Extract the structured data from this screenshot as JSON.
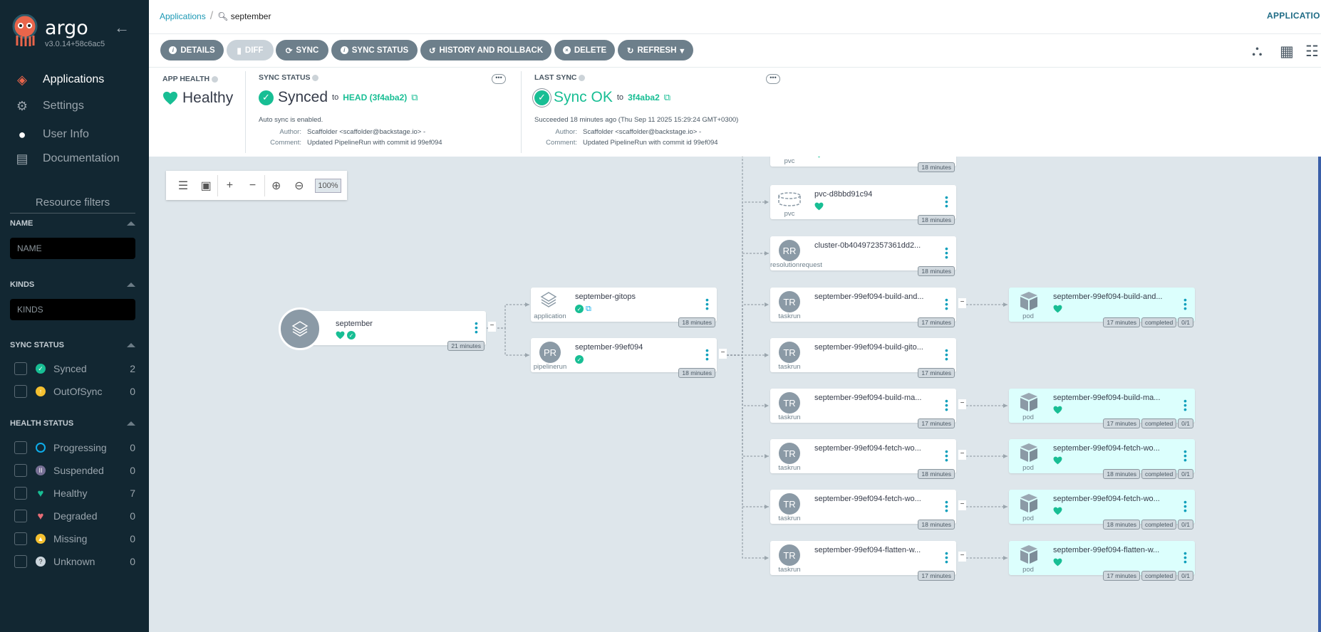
{
  "sidebar": {
    "brand": "argo",
    "version": "v3.0.14+58c6ac5",
    "nav": [
      {
        "label": "Applications",
        "icon": "layers-icon",
        "active": true
      },
      {
        "label": "Settings",
        "icon": "gear-icon"
      },
      {
        "label": "User Info",
        "icon": "user-icon"
      },
      {
        "label": "Documentation",
        "icon": "book-icon"
      }
    ],
    "filters_title": "Resource filters",
    "name_label": "NAME",
    "name_placeholder": "NAME",
    "kinds_label": "KINDS",
    "kinds_placeholder": "KINDS",
    "sync_label": "SYNC STATUS",
    "sync_items": [
      {
        "label": "Synced",
        "count": "2",
        "color": "#18be94"
      },
      {
        "label": "OutOfSync",
        "count": "0",
        "color": "#f4c030"
      }
    ],
    "health_label": "HEALTH STATUS",
    "health_items": [
      {
        "label": "Progressing",
        "count": "0",
        "color": "#0dadea"
      },
      {
        "label": "Suspended",
        "count": "0",
        "color": "#766f94"
      },
      {
        "label": "Healthy",
        "count": "7",
        "color": "#18be94"
      },
      {
        "label": "Degraded",
        "count": "0",
        "color": "#e96d76"
      },
      {
        "label": "Missing",
        "count": "0",
        "color": "#f4c030"
      },
      {
        "label": "Unknown",
        "count": "0",
        "color": "#ccd6dd"
      }
    ]
  },
  "breadcrumb": {
    "root": "Applications",
    "current": "september"
  },
  "page_title": "APPLICATIO",
  "toolbar": {
    "details": "DETAILS",
    "diff": "DIFF",
    "sync": "SYNC",
    "sync_status": "SYNC STATUS",
    "history": "HISTORY AND ROLLBACK",
    "delete": "DELETE",
    "refresh": "REFRESH"
  },
  "app_health": {
    "label": "APP HEALTH",
    "value": "Healthy"
  },
  "sync_status": {
    "label": "SYNC STATUS",
    "value": "Synced",
    "to": "to",
    "revision": "HEAD (3f4aba2)",
    "auto": "Auto sync is enabled.",
    "author_key": "Author:",
    "author": "Scaffolder <scaffolder@backstage.io> -",
    "comment_key": "Comment:",
    "comment": "Updated PipelineRun with commit id 99ef094"
  },
  "last_sync": {
    "label": "LAST SYNC",
    "value": "Sync OK",
    "to": "to",
    "revision": "3f4aba2",
    "succeeded": "Succeeded 18 minutes ago (Thu Sep 11 2025 15:29:24 GMT+0300)",
    "author_key": "Author:",
    "author": "Scaffolder <scaffolder@backstage.io> -",
    "comment_key": "Comment:",
    "comment": "Updated PipelineRun with commit id 99ef094"
  },
  "zoom": {
    "level": "100%"
  },
  "graph": {
    "root": {
      "name": "september",
      "age": "21 minutes",
      "health": "healthy",
      "sync": "synced"
    },
    "level1": [
      {
        "name": "september-gitops",
        "kind": "application",
        "icon": "layers",
        "age": "18 minutes",
        "status": [
          "synced",
          "link"
        ]
      },
      {
        "name": "september-99ef094",
        "kind": "pipelinerun",
        "icon": "PR",
        "age": "18 minutes",
        "status": [
          "synced"
        ]
      }
    ],
    "level2": [
      {
        "name": "",
        "kind": "pvc",
        "icon": "pvc",
        "age": "18 minutes",
        "status": [
          "healthy"
        ]
      },
      {
        "name": "pvc-d8bbd91c94",
        "kind": "pvc",
        "icon": "pvc",
        "age": "18 minutes",
        "status": [
          "healthy"
        ]
      },
      {
        "name": "cluster-0b404972357361dd2...",
        "kind": "resolutionrequest",
        "icon": "RR",
        "age": "18 minutes",
        "status": []
      },
      {
        "name": "september-99ef094-build-and...",
        "kind": "taskrun",
        "icon": "TR",
        "age": "17 minutes",
        "status": [],
        "pod": 0
      },
      {
        "name": "september-99ef094-build-gito...",
        "kind": "taskrun",
        "icon": "TR",
        "age": "17 minutes",
        "status": []
      },
      {
        "name": "september-99ef094-build-ma...",
        "kind": "taskrun",
        "icon": "TR",
        "age": "17 minutes",
        "status": [],
        "pod": 1
      },
      {
        "name": "september-99ef094-fetch-wo...",
        "kind": "taskrun",
        "icon": "TR",
        "age": "18 minutes",
        "status": [],
        "pod": 2
      },
      {
        "name": "september-99ef094-fetch-wo...",
        "kind": "taskrun",
        "icon": "TR",
        "age": "18 minutes",
        "status": [],
        "pod": 3
      },
      {
        "name": "september-99ef094-flatten-w...",
        "kind": "taskrun",
        "icon": "TR",
        "age": "17 minutes",
        "status": [],
        "pod": 4
      }
    ],
    "pods": [
      {
        "name": "september-99ef094-build-and...",
        "kind": "pod",
        "age": "17 minutes",
        "phase": "completed",
        "ready": "0/1"
      },
      {
        "name": "september-99ef094-build-ma...",
        "kind": "pod",
        "age": "17 minutes",
        "phase": "completed",
        "ready": "0/1"
      },
      {
        "name": "september-99ef094-fetch-wo...",
        "kind": "pod",
        "age": "18 minutes",
        "phase": "completed",
        "ready": "0/1"
      },
      {
        "name": "september-99ef094-fetch-wo...",
        "kind": "pod",
        "age": "18 minutes",
        "phase": "completed",
        "ready": "0/1"
      },
      {
        "name": "september-99ef094-flatten-w...",
        "kind": "pod",
        "age": "17 minutes",
        "phase": "completed",
        "ready": "0/1"
      }
    ]
  },
  "colors": {
    "accent": "#18be94",
    "link": "#0dadea",
    "sidebar": "#122732",
    "button": "#6d7f8b"
  }
}
